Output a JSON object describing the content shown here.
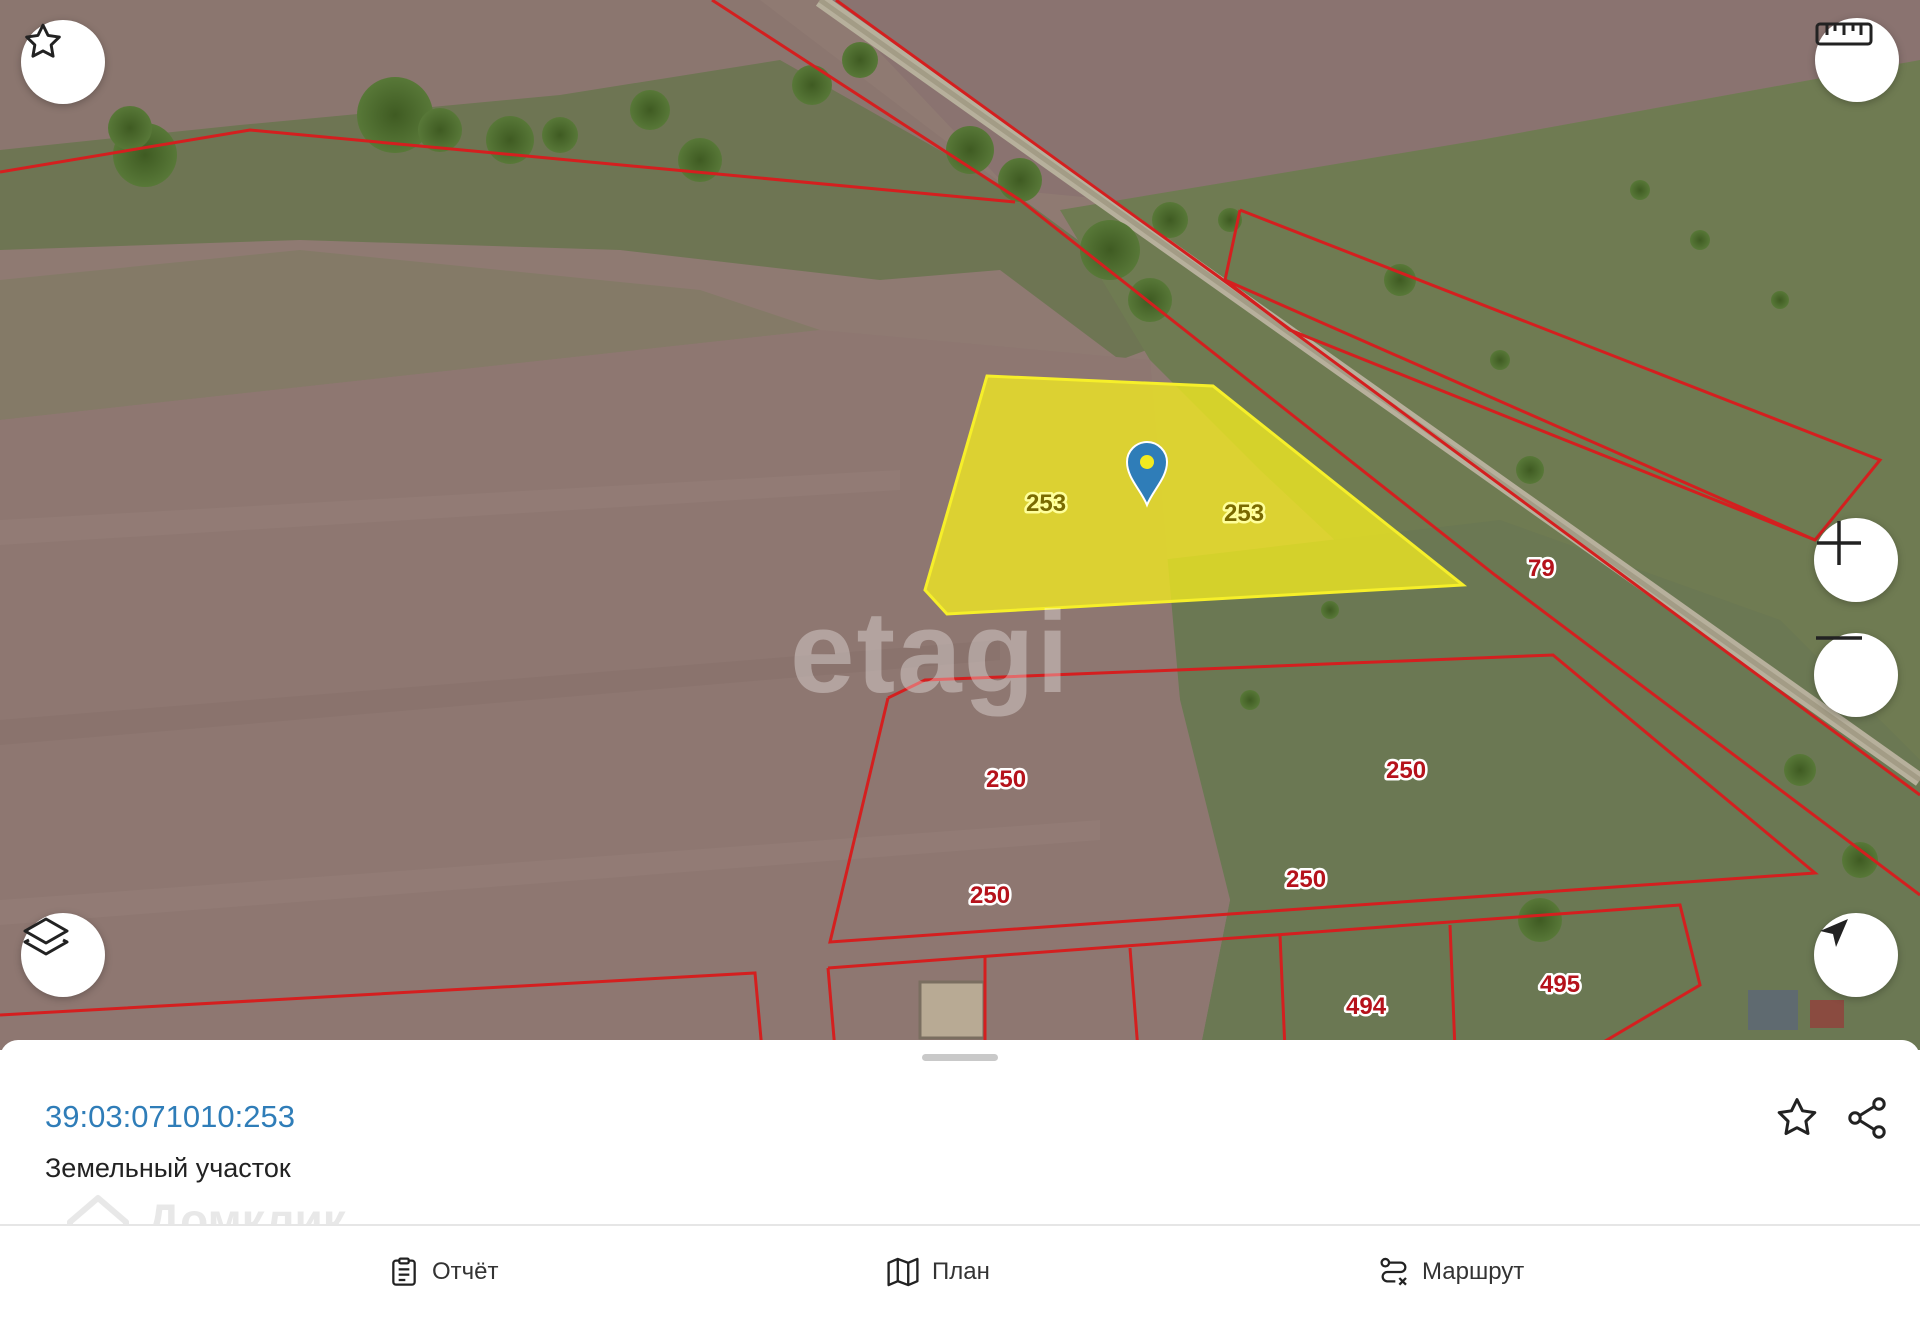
{
  "map": {
    "plot_labels": [
      {
        "id": "sel-1",
        "text": "253",
        "selected": true
      },
      {
        "id": "sel-2",
        "text": "253",
        "selected": true
      },
      {
        "id": "road",
        "text": "79",
        "selected": false
      },
      {
        "id": "p250a",
        "text": "250",
        "selected": false
      },
      {
        "id": "p250b",
        "text": "250",
        "selected": false
      },
      {
        "id": "p250c",
        "text": "250",
        "selected": false
      },
      {
        "id": "p250d",
        "text": "250",
        "selected": false
      },
      {
        "id": "p494",
        "text": "494",
        "selected": false
      },
      {
        "id": "p495",
        "text": "495",
        "selected": false
      }
    ],
    "watermark": "etagi",
    "colors": {
      "boundary": "#d41f1f",
      "selected_fill": "#f2ea20",
      "marker": "#2f7db8"
    },
    "controls": [
      "star-icon",
      "ruler-icon",
      "plus-icon",
      "minus-icon",
      "layers-icon",
      "navigation-icon"
    ]
  },
  "sheet": {
    "cadastral_number": "39:03:071010:253",
    "object_type": "Земельный участок",
    "watermark": "Домклик"
  },
  "nav": {
    "report": "Отчёт",
    "plan": "План",
    "route": "Маршрут"
  }
}
